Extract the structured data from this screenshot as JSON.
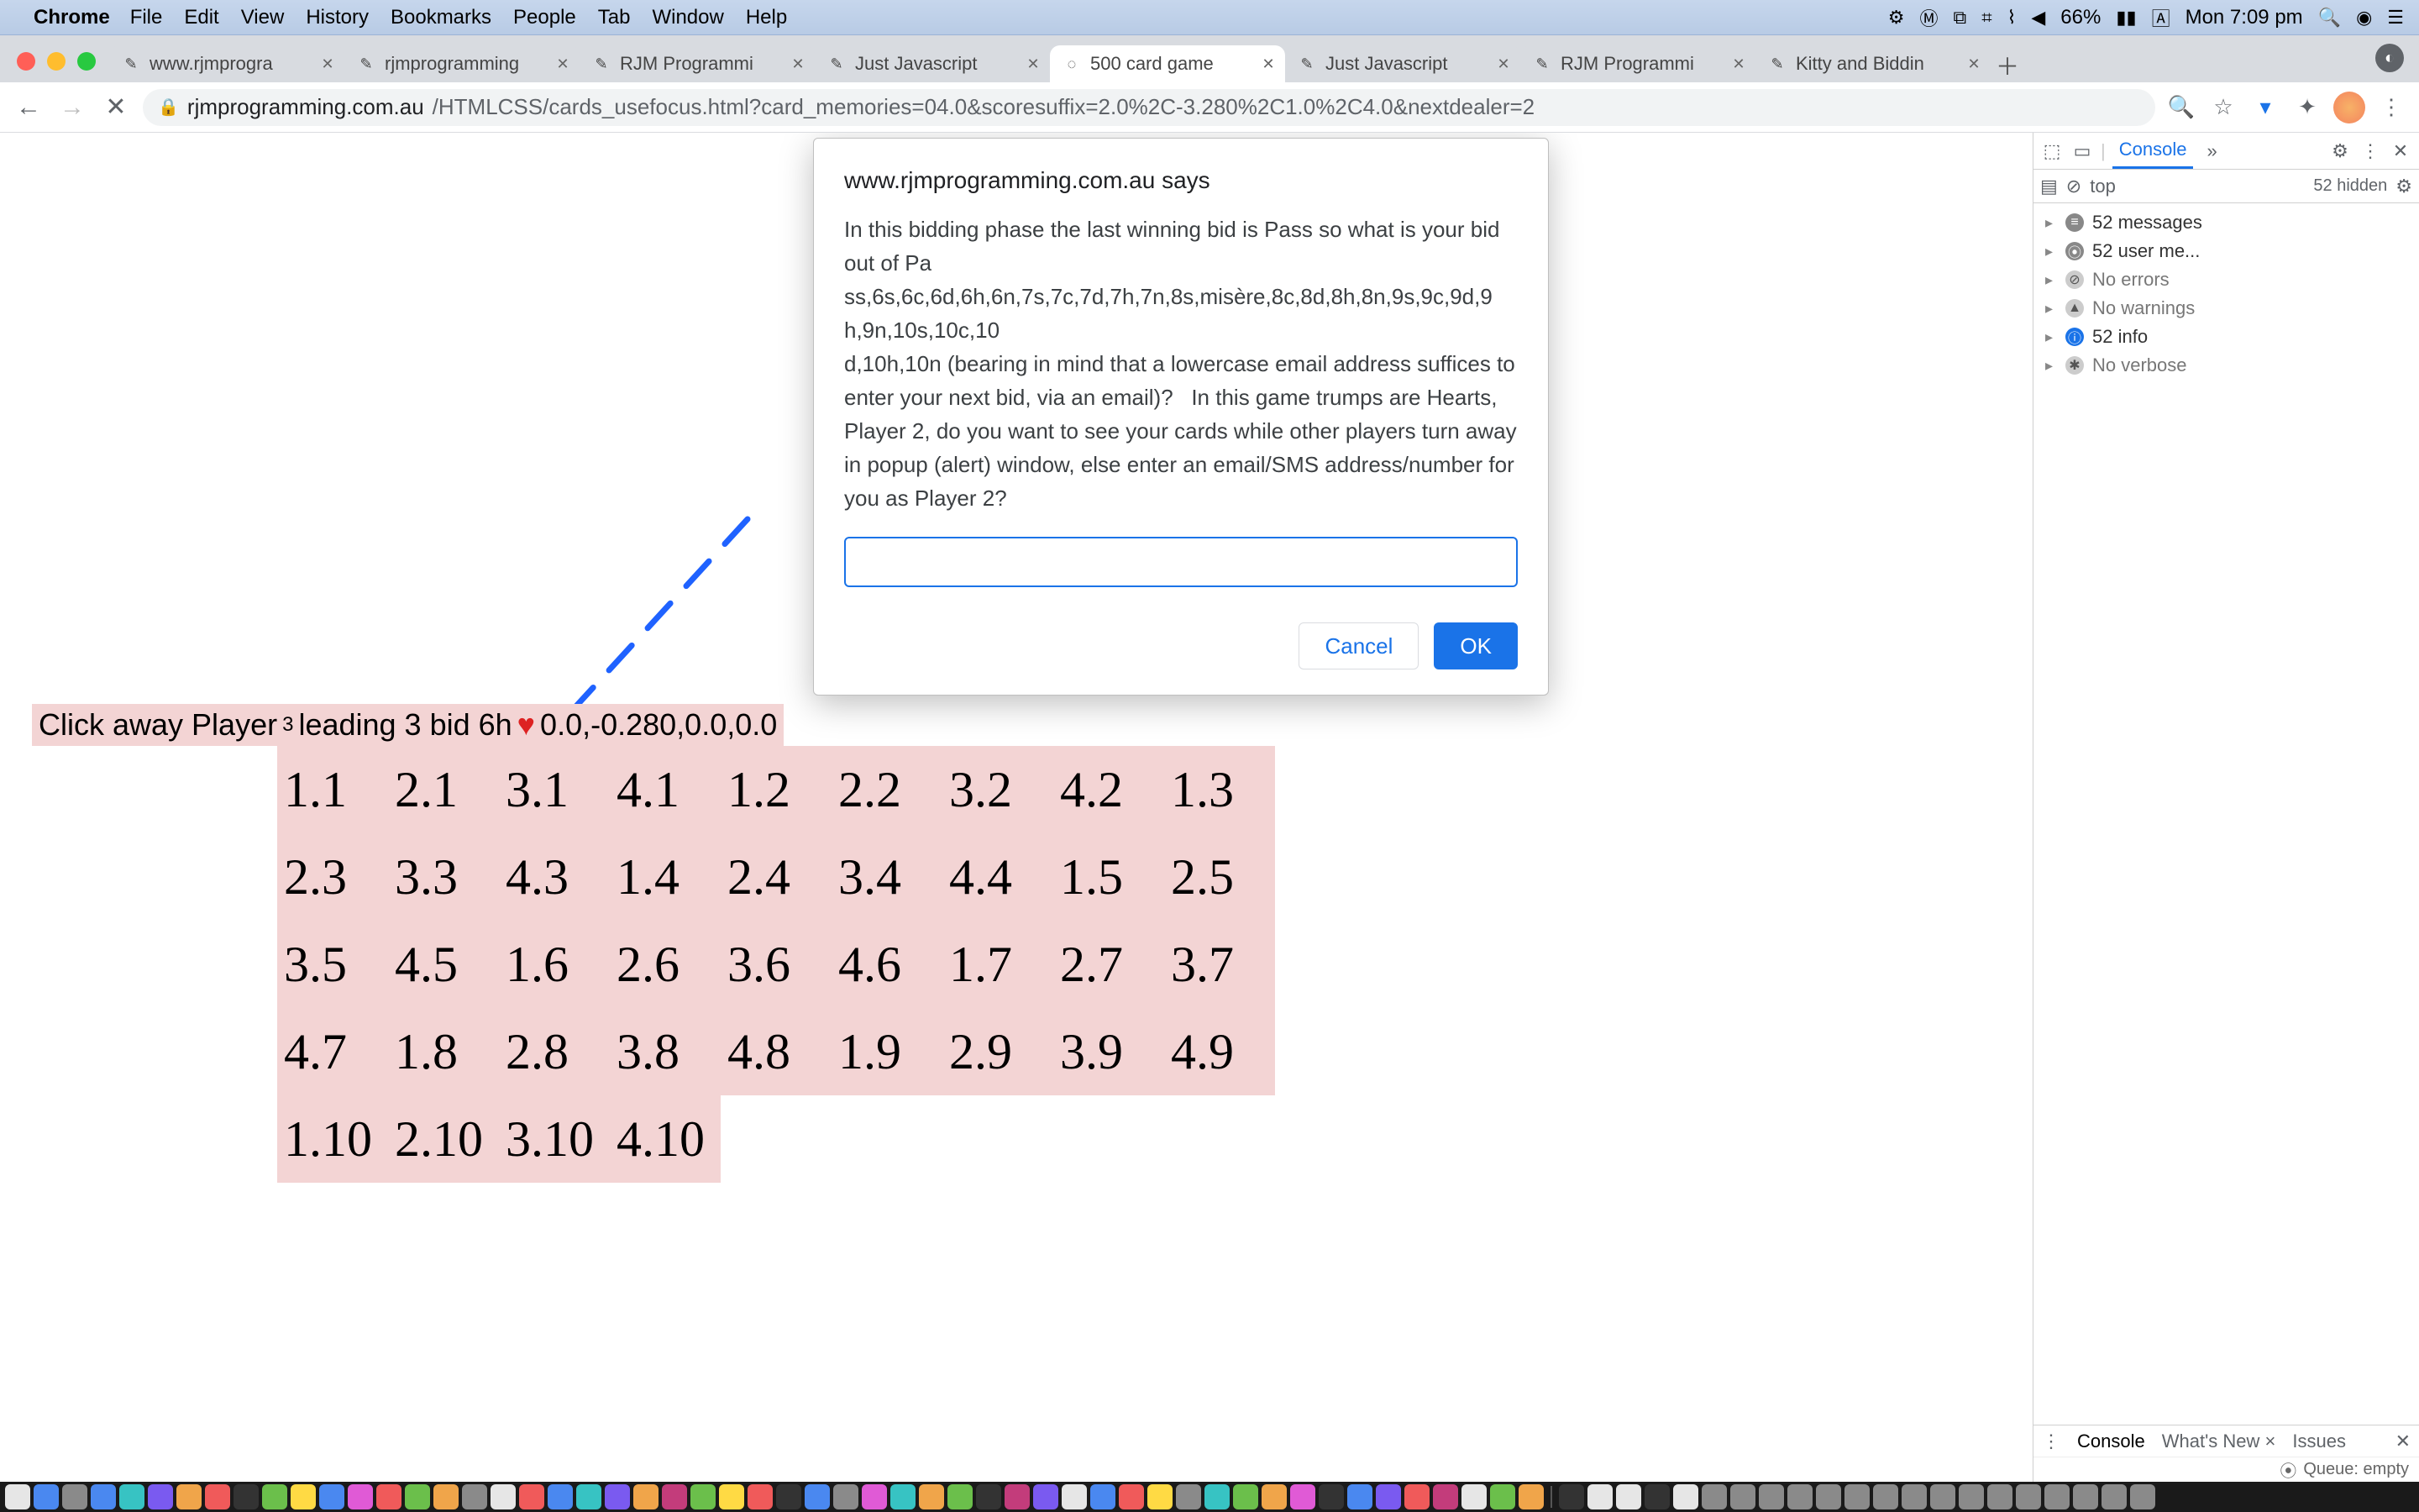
{
  "menubar": {
    "app": "Chrome",
    "items": [
      "File",
      "Edit",
      "View",
      "History",
      "Bookmarks",
      "People",
      "Tab",
      "Window",
      "Help"
    ],
    "battery": "66%",
    "clock": "Mon 7:09 pm"
  },
  "tabs": [
    {
      "title": "www.rjmprogra"
    },
    {
      "title": "rjmprogramming"
    },
    {
      "title": "RJM Programmi"
    },
    {
      "title": "Just Javascript"
    },
    {
      "title": "500 card game",
      "active": true
    },
    {
      "title": "Just Javascript"
    },
    {
      "title": "RJM Programmi"
    },
    {
      "title": "Kitty and Biddin"
    }
  ],
  "url": {
    "domain": "rjmprogramming.com.au",
    "path": "/HTMLCSS/cards_usefocus.html?card_memories=04.0&scoresuffix=2.0%2C-3.280%2C1.0%2C4.0&nextdealer=2"
  },
  "dialog": {
    "host": "www.rjmprogramming.com.au says",
    "body": "In this bidding phase the last winning bid is Pass so what is your bid out of Pa\nss,6s,6c,6d,6h,6n,7s,7c,7d,7h,7n,8s,misère,8c,8d,8h,8n,9s,9c,9d,9\nh,9n,10s,10c,10\nd,10h,10n (bearing in mind that a lowercase email address suffices to enter your next bid, via an email)?   In this game trumps are Hearts, Player 2, do you want to see your cards while other players turn away in popup (alert) window, else enter an email/SMS address/number for you as Player 2?",
    "cancel": "Cancel",
    "ok": "OK"
  },
  "status": {
    "prefix": "Click away Player",
    "sub": "3",
    "mid": " leading 3 bid 6h ",
    "heart": "♥",
    "scores": " 0.0,-0.280,0.0,0.0"
  },
  "grid": [
    [
      "1.1",
      "2.1",
      "3.1",
      "4.1",
      "1.2",
      "2.2",
      "3.2",
      "4.2",
      "1.3"
    ],
    [
      "2.3",
      "3.3",
      "4.3",
      "1.4",
      "2.4",
      "3.4",
      "4.4",
      "1.5",
      "2.5"
    ],
    [
      "3.5",
      "4.5",
      "1.6",
      "2.6",
      "3.6",
      "4.6",
      "1.7",
      "2.7",
      "3.7"
    ],
    [
      "4.7",
      "1.8",
      "2.8",
      "3.8",
      "4.8",
      "1.9",
      "2.9",
      "3.9",
      "4.9"
    ],
    [
      "1.10",
      "2.10",
      "3.10",
      "4.10",
      "",
      "",
      "",
      "",
      ""
    ]
  ],
  "devtools": {
    "tab": "Console",
    "context": "top",
    "hidden": "52 hidden",
    "lines": [
      {
        "type": "msg",
        "text": "52 messages"
      },
      {
        "type": "user",
        "text": "52 user me..."
      },
      {
        "type": "err",
        "text": "No errors"
      },
      {
        "type": "warn",
        "text": "No warnings"
      },
      {
        "type": "info",
        "text": "52 info"
      },
      {
        "type": "verb",
        "text": "No verbose"
      }
    ],
    "bottom": [
      "Console",
      "What's New ×",
      "Issues"
    ],
    "queue": "Queue: empty"
  }
}
